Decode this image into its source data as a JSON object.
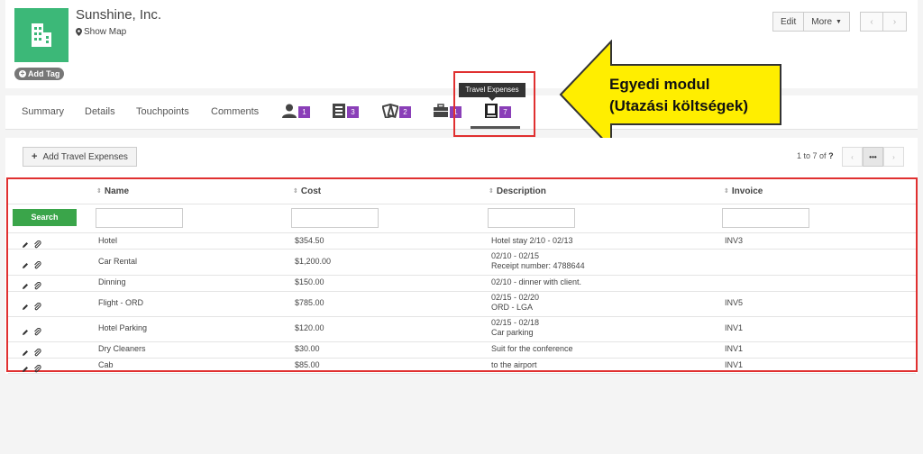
{
  "company": {
    "name": "Sunshine, Inc.",
    "show_map": "Show Map",
    "add_tag": "Add Tag"
  },
  "toolbar": {
    "edit_label": "Edit",
    "more_label": "More"
  },
  "tabs": {
    "summary": "Summary",
    "details": "Details",
    "touchpoints": "Touchpoints",
    "comments": "Comments",
    "icon_tabs": [
      {
        "icon": "person-icon",
        "count": "1"
      },
      {
        "icon": "id-card-icon",
        "count": "3"
      },
      {
        "icon": "money-icon",
        "count": "2"
      },
      {
        "icon": "briefcase-icon",
        "count": "1"
      },
      {
        "icon": "book-icon",
        "count": "7"
      }
    ],
    "tooltip": "Travel Expenses"
  },
  "callout": {
    "line1": "Egyedi modul",
    "line2": "(Utazási költségek)"
  },
  "actions": {
    "add_expenses": "Add Travel Expenses",
    "search": "Search"
  },
  "pager": {
    "range": "1 to 7",
    "of": "of",
    "total": "?",
    "more": "•••"
  },
  "table": {
    "headers": [
      "Name",
      "Cost",
      "Description",
      "Invoice"
    ],
    "rows": [
      {
        "name": "Hotel",
        "cost": "$354.50",
        "desc1": "Hotel stay 2/10 - 02/13",
        "desc2": "",
        "invoice": "INV3"
      },
      {
        "name": "Car Rental",
        "cost": "$1,200.00",
        "desc1": "02/10 - 02/15",
        "desc2": "Receipt number: 4788644",
        "invoice": ""
      },
      {
        "name": "Dinning",
        "cost": "$150.00",
        "desc1": "02/10 - dinner with client.",
        "desc2": "",
        "invoice": ""
      },
      {
        "name": "Flight - ORD",
        "cost": "$785.00",
        "desc1": "02/15 - 02/20",
        "desc2": "ORD - LGA",
        "invoice": "INV5"
      },
      {
        "name": "Hotel Parking",
        "cost": "$120.00",
        "desc1": "02/15 - 02/18",
        "desc2": "Car parking",
        "invoice": "INV1"
      },
      {
        "name": "Dry Cleaners",
        "cost": "$30.00",
        "desc1": "Suit for the conference",
        "desc2": "",
        "invoice": "INV1"
      },
      {
        "name": "Cab",
        "cost": "$85.00",
        "desc1": "to the airport",
        "desc2": "",
        "invoice": "INV1"
      }
    ]
  },
  "colors": {
    "logo_green": "#3cb878",
    "badge_purple": "#8a3fb8",
    "highlight_red": "#e03030",
    "callout_yellow": "#ffee00",
    "search_green": "#3aa54a"
  }
}
